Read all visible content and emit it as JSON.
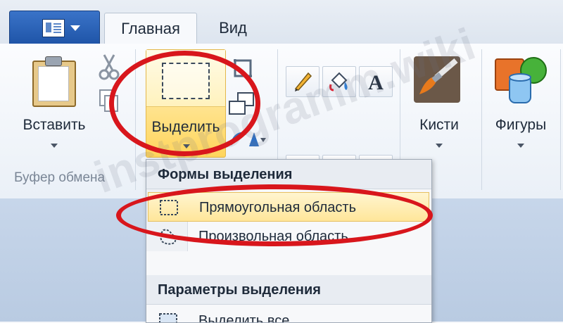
{
  "tabs": {
    "home": "Главная",
    "view": "Вид"
  },
  "clipboard": {
    "paste_label": "Вставить",
    "group_label": "Буфер обмена"
  },
  "image_group": {
    "select_label": "Выделить"
  },
  "tools_group": {
    "brushes_label": "Кисти",
    "shapes_label": "Фигуры"
  },
  "selection_menu": {
    "shapes_header": "Формы выделения",
    "rect_selection": "Прямоугольная область",
    "free_selection": "Произвольная область",
    "options_header": "Параметры выделения",
    "next_item_partial": "Выделить все"
  },
  "watermark": "instprogramm.wiki",
  "icons": [
    "app-menu-icon",
    "paste-icon",
    "cut-icon",
    "copy-icon",
    "pencil-icon",
    "fill-icon",
    "text-icon",
    "eraser-icon",
    "color-picker-icon",
    "magnifier-icon",
    "brush-icon",
    "shapes-icon",
    "rect-select-icon",
    "free-select-icon"
  ],
  "colors": {
    "highlight": "#ffe38d",
    "annotation": "#d8161c",
    "app_button": "#2a63b8"
  }
}
